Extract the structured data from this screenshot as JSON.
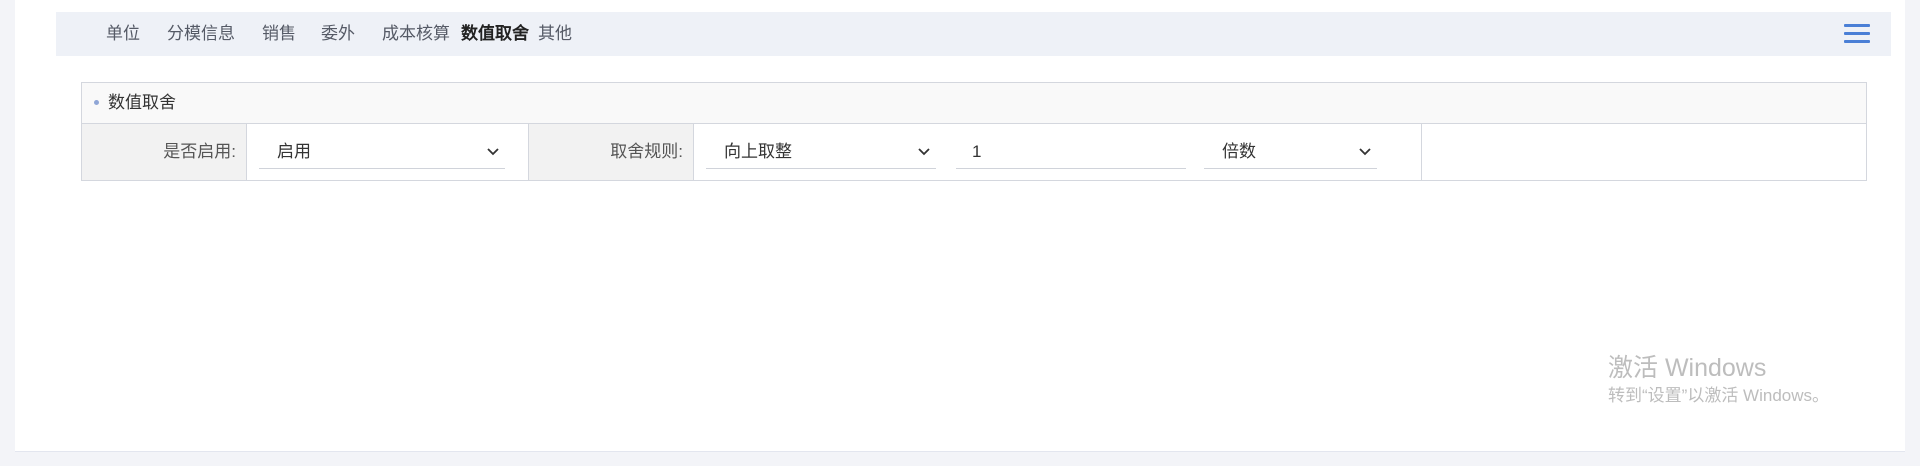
{
  "tabs": [
    {
      "label": "单位",
      "active": false
    },
    {
      "label": "分模信息",
      "active": false
    },
    {
      "label": "销售",
      "active": false
    },
    {
      "label": "委外",
      "active": false
    },
    {
      "label": "成本核算",
      "active": false
    },
    {
      "label": "数值取舍",
      "active": true
    },
    {
      "label": "其他",
      "active": false
    }
  ],
  "menu_icon": "hamburger-menu-icon",
  "panel": {
    "title": "数值取舍",
    "enable_label": "是否启用:",
    "enable_value": "启用",
    "rule_label": "取舍规则:",
    "rule_value": "向上取整",
    "number_value": "1",
    "multiple_value": "倍数"
  },
  "watermark": {
    "title": "激活 Windows",
    "subtitle": "转到“设置”以激活 Windows。"
  },
  "colors": {
    "accent": "#4a7fd6",
    "tabbar_bg": "#eef1f7",
    "label_bg": "#f2f2f2",
    "border": "#d4d7de"
  }
}
